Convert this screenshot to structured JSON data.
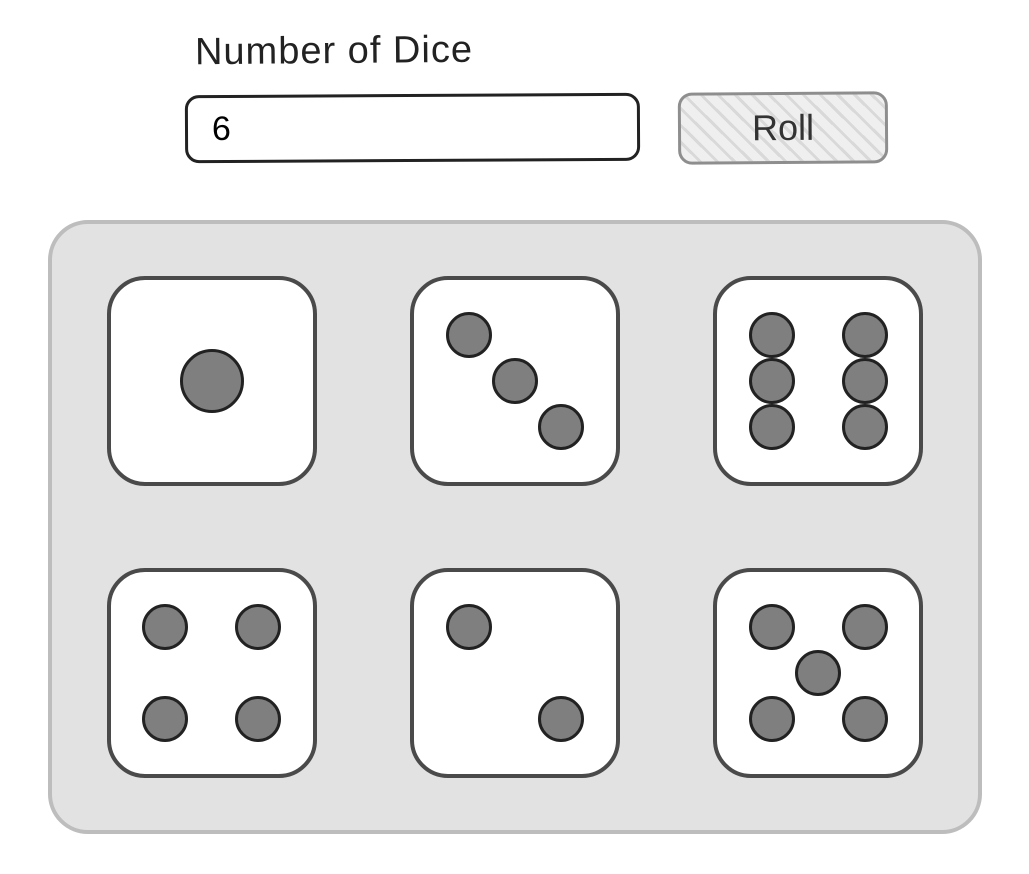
{
  "controls": {
    "label": "Number of Dice",
    "dice_count_value": "6",
    "roll_label": "Roll"
  },
  "dice": [
    1,
    3,
    6,
    4,
    2,
    5
  ],
  "colors": {
    "tray_bg": "#e2e2e2",
    "tray_border": "#bdbdbd",
    "die_border": "#4a4a4a",
    "pip_fill": "#7f7f7f",
    "pip_outline": "#222222"
  }
}
